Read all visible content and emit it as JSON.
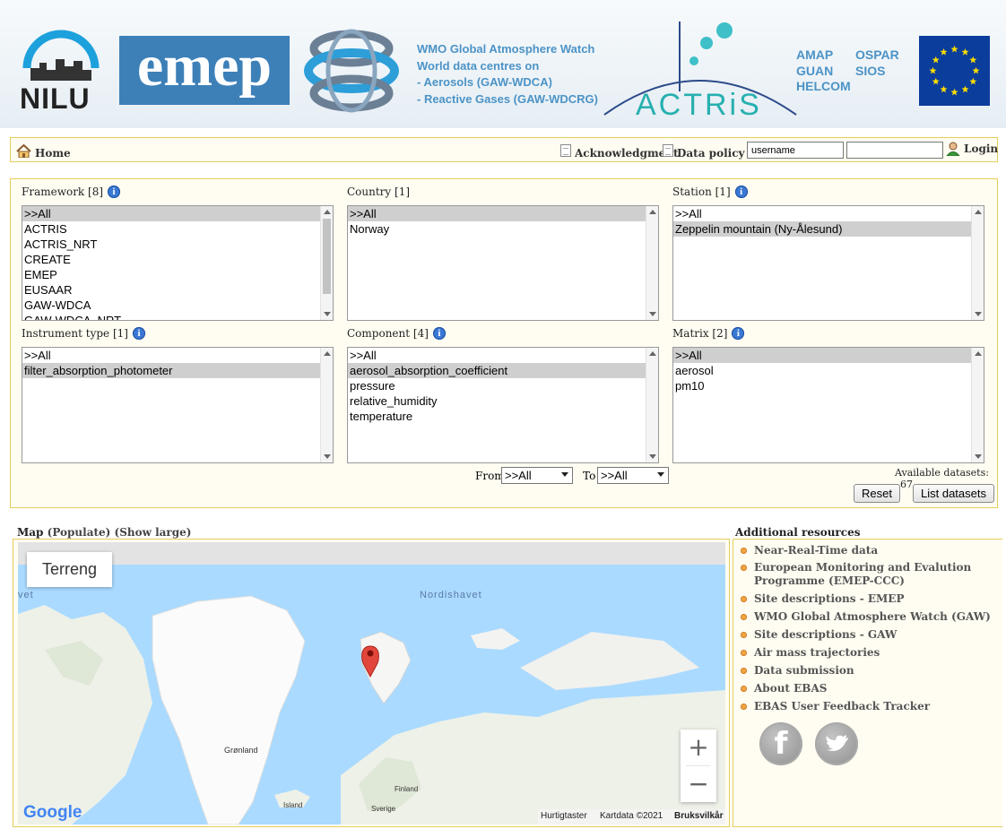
{
  "header": {
    "nilu_label": "NILU",
    "emep_label": "emep",
    "wmo_lines": [
      "WMO Global Atmosphere Watch",
      "World data centres on",
      "- Aerosols (GAW-WDCA)",
      "- Reactive Gases (GAW-WDCRG)"
    ],
    "actris_label": "ACTRiS",
    "networks_col1": [
      "AMAP",
      "GUAN",
      "HELCOM"
    ],
    "networks_col2": [
      "OSPAR",
      "SIOS"
    ]
  },
  "nav": {
    "home": "Home",
    "acknowledgment": "Acknowledgment",
    "data_policy": "Data policy",
    "username_value": "username",
    "password_value": "",
    "login": "Login"
  },
  "filters": {
    "framework": {
      "label": "Framework [8]",
      "options": [
        ">>All",
        "ACTRIS",
        "ACTRIS_NRT",
        "CREATE",
        "EMEP",
        "EUSAAR",
        "GAW-WDCA",
        "GAW-WDCA_NRT"
      ],
      "selected": 0
    },
    "country": {
      "label": "Country [1]",
      "options": [
        ">>All",
        "Norway"
      ],
      "selected": 0
    },
    "station": {
      "label": "Station [1]",
      "options": [
        ">>All",
        "Zeppelin mountain (Ny-Ålesund)"
      ],
      "selected": 1
    },
    "instrument_type": {
      "label": "Instrument type [1]",
      "options": [
        ">>All",
        "filter_absorption_photometer"
      ],
      "selected": 1
    },
    "component": {
      "label": "Component [4]",
      "options": [
        ">>All",
        "aerosol_absorption_coefficient",
        "pressure",
        "relative_humidity",
        "temperature"
      ],
      "selected": 1
    },
    "matrix": {
      "label": "Matrix [2]",
      "options": [
        ">>All",
        "aerosol",
        "pm10"
      ],
      "selected": 0
    }
  },
  "date_range": {
    "from_label": "From",
    "from_value": ">>All",
    "to_label": "To",
    "to_value": ">>All"
  },
  "available": {
    "label": "Available datasets:",
    "count": "67"
  },
  "buttons": {
    "reset": "Reset",
    "list": "List datasets"
  },
  "map": {
    "title": "Map",
    "populate": "(Populate)",
    "show_large": "(Show large)",
    "map_type": "Terreng",
    "labels": {
      "nordishavet": "Nordishavet",
      "vet": "vet",
      "gronland": "Grønland",
      "island": "Island",
      "finland": "Finland",
      "sverige": "Sverige"
    },
    "zoom_in": "+",
    "zoom_out": "−",
    "google": "Google",
    "footer_shortcuts": "Hurtigtaster",
    "footer_mapdata": "Kartdata ©2021",
    "footer_terms": "Bruksvilkår",
    "marker_color": "#e2463b"
  },
  "resources": {
    "title": "Additional resources",
    "items": [
      "Near-Real-Time data",
      "European Monitoring and Evalution Programme (EMEP-CCC)",
      "Site descriptions - EMEP",
      "WMO Global Atmosphere Watch (GAW)",
      "Site descriptions - GAW",
      "Air mass trajectories",
      "Data submission",
      "About EBAS",
      "EBAS User Feedback Tracker"
    ],
    "facebook_glyph": "f"
  },
  "colors": {
    "panel_border": "#e6cd5a",
    "panel_bg": "#fffdf2",
    "bullet": "#f1a545",
    "ocean": "#aadaff"
  }
}
